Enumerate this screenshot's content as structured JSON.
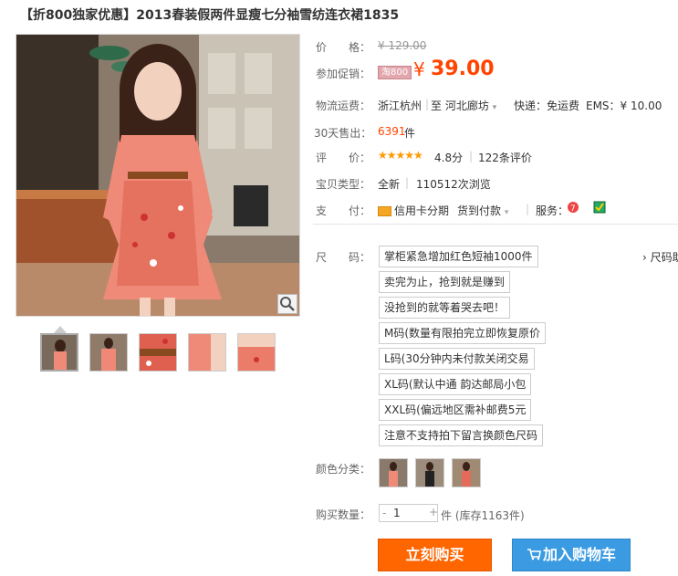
{
  "title": "【折800独家优惠】2013春装假两件显瘦七分袖雪纺连衣裙1835",
  "price": {
    "label": "价　　格：",
    "old": "¥ 129.00"
  },
  "promo": {
    "label": "参加促销：",
    "badge": "淘800",
    "currency": "¥",
    "amount": "39.00"
  },
  "shipping": {
    "label": "物流运费：",
    "from": "浙江杭州",
    "to": "至  河北廊坊",
    "express": "快递：免运费",
    "ems": "EMS：¥ 10.00"
  },
  "sales30": {
    "label": "30天售出：",
    "count": "6391",
    "unit": "件"
  },
  "rating": {
    "label": "评　　价：",
    "stars": "★★★★★",
    "score": "4.8分",
    "reviews": "122条评价"
  },
  "type": {
    "label": "宝贝类型：",
    "condition": "全新",
    "views": "110512次浏览"
  },
  "payment": {
    "label": "支　　付：",
    "credit": "信用卡分期",
    "cod": "货到付款",
    "service_label": "服务："
  },
  "size": {
    "label": "尺　　码：",
    "guide": "› 尺码助",
    "options": [
      "掌柜紧急增加红色短袖1000件",
      "卖完为止，抢到就是赚到",
      "没抢到的就等着哭去吧！",
      "M码(数量有限拍完立即恢复原价",
      "L码(30分钟内未付款关闭交易",
      "XL码(默认中通 韵达邮局小包",
      "XXL码(偏远地区需补邮费5元",
      "注意不支持拍下留言换颜色尺码"
    ]
  },
  "color": {
    "label": "颜色分类："
  },
  "quantity": {
    "label": "购买数量：",
    "minus": "-",
    "value": "1",
    "plus": "+",
    "stock": "件 (库存1163件)"
  },
  "buttons": {
    "buy": "立刻购买",
    "cart": "加入购物车"
  },
  "colors": {
    "accent": "#ff4400",
    "buy_bg": "#ff6600",
    "cart_bg": "#3a9be3"
  }
}
